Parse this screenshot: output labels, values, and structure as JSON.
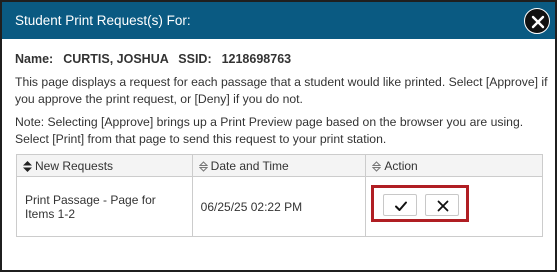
{
  "dialog": {
    "title": "Student Print Request(s) For:",
    "close_icon": "close-icon",
    "title_bar_color": "#0a5a82"
  },
  "student": {
    "name_label": "Name:",
    "name": "CURTIS, JOSHUA",
    "ssid_label": "SSID:",
    "ssid": "1218698763"
  },
  "instructions": {
    "para1": "This page displays a request for each passage that a student would like printed. Select [Approve] if you approve the print request, or [Deny] if you do not.",
    "para2": "Note: Selecting [Approve] brings up a Print Preview page based on the browser you are using. Select [Print] from that page to send this request to your print station."
  },
  "table": {
    "headers": [
      "New Requests",
      "Date and Time",
      "Action"
    ],
    "header_icons": [
      "sort-active-icon",
      "sort-icon",
      "sort-icon"
    ],
    "rows": [
      {
        "request": "Print Passage - Page for Items 1-2",
        "datetime": "06/25/25 02:22 PM",
        "approve_icon": "checkmark-icon",
        "deny_icon": "x-icon"
      }
    ]
  },
  "colors": {
    "highlight": "#b01e23"
  }
}
